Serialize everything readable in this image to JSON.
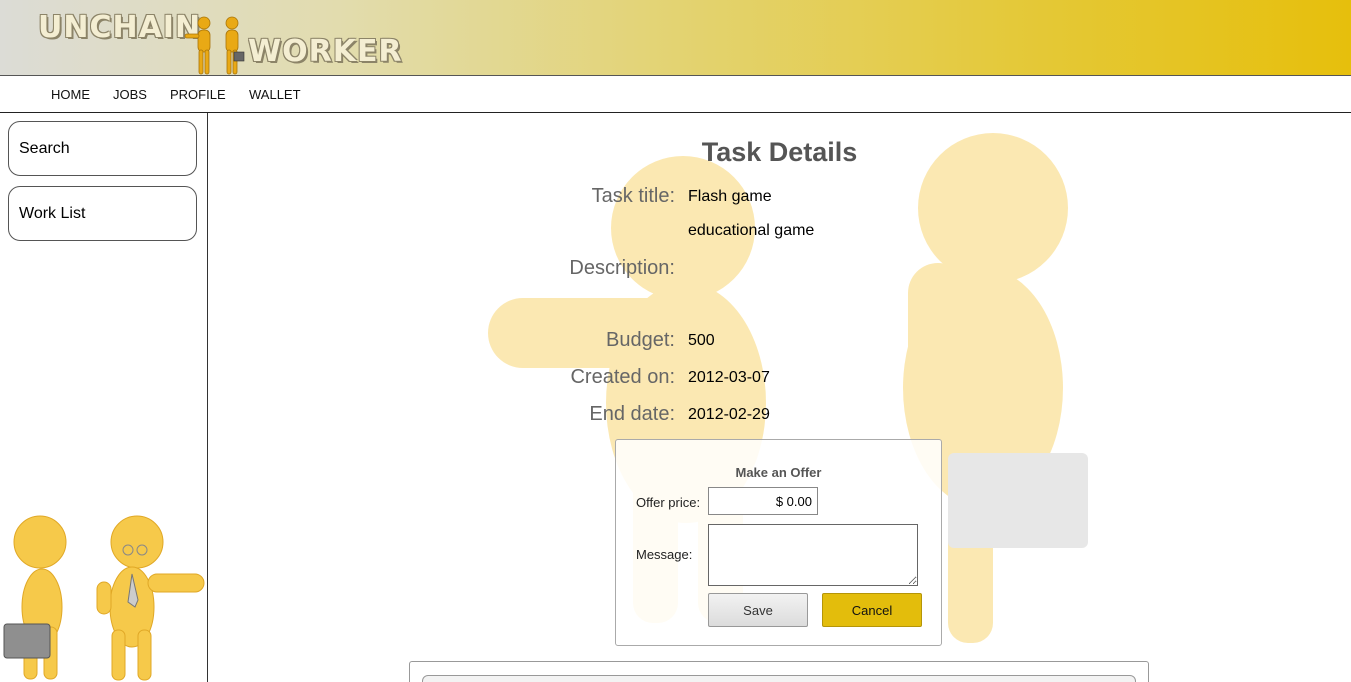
{
  "logo": {
    "text_left": "UNCHAIN",
    "text_right": "WORKER"
  },
  "nav": {
    "items": [
      "HOME",
      "JOBS",
      "PROFILE",
      "WALLET"
    ]
  },
  "sidebar": {
    "items": [
      {
        "label": "Search"
      },
      {
        "label": "Work List"
      }
    ]
  },
  "page": {
    "title": "Task Details"
  },
  "details": {
    "task_title_label": "Task title:",
    "task_title_value": "Flash game",
    "subtitle_value": "educational game",
    "description_label": "Description:",
    "budget_label": "Budget:",
    "budget_value": "500",
    "created_label": "Created on:",
    "created_value": "2012-03-07",
    "end_label": "End date:",
    "end_value": "2012-02-29"
  },
  "offer": {
    "title": "Make an Offer",
    "price_label": "Offer price:",
    "price_value": "$ 0.00",
    "message_label": "Message:",
    "message_value": "",
    "save_label": "Save",
    "cancel_label": "Cancel"
  },
  "colors": {
    "accent": "#e3bd0c",
    "label_gray": "#666666"
  }
}
